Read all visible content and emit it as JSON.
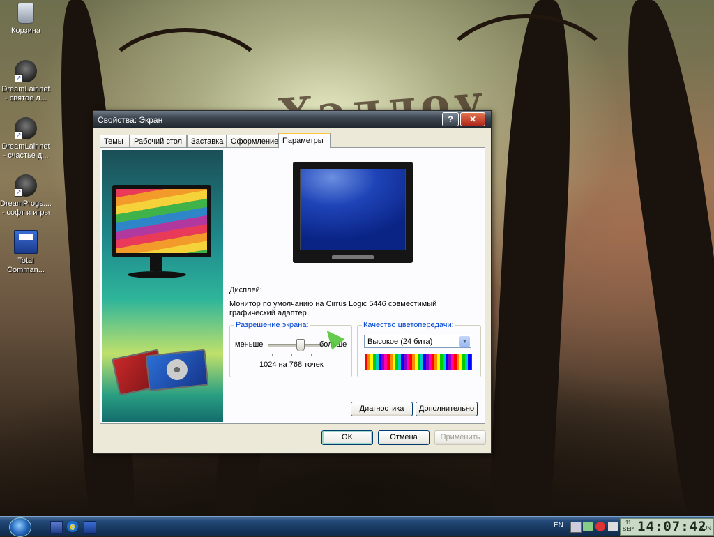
{
  "desktop": {
    "icons": [
      {
        "label": "Корзина"
      },
      {
        "label": "DreamLair.net - святое л..."
      },
      {
        "label": "DreamLair.net - счастье д..."
      },
      {
        "label": "DreamProgs.... - софт и игры"
      },
      {
        "label": "Total Comman..."
      }
    ],
    "wallpaper_text": "Хэллоу"
  },
  "window": {
    "title": "Свойства: Экран",
    "help_button": "?",
    "close_button": "✕",
    "tabs": [
      {
        "label": "Темы"
      },
      {
        "label": "Рабочий стол"
      },
      {
        "label": "Заставка"
      },
      {
        "label": "Оформление"
      },
      {
        "label": "Параметры",
        "active": true
      }
    ],
    "display_label": "Дисплей:",
    "display_value": "Монитор по умолчанию на Cirrus Logic 5446 совместимый графический адаптер",
    "resolution": {
      "legend": "Разрешение экрана:",
      "less": "меньше",
      "more": "больше",
      "value_text": "1024 на 768 точек",
      "slider_level": 0.6
    },
    "color_quality": {
      "legend": "Качество цветопередачи:",
      "selected": "Высокое (24 бита)",
      "dropdown_arrow": "▼"
    },
    "buttons": {
      "diagnostics": "Диагностика",
      "advanced": "Дополнительно",
      "ok": "OK",
      "cancel": "Отмена",
      "apply": "Применить"
    }
  },
  "taskbar": {
    "language": "EN",
    "clock": {
      "day": "11",
      "month": "SEP",
      "time": "14:07:42",
      "weekday": "SUN"
    }
  },
  "colors": {
    "titlebar": "#3d4650",
    "active_tab_accent": "#ffc83c",
    "legend_text": "#0046d5",
    "taskbar": "#17375e"
  }
}
